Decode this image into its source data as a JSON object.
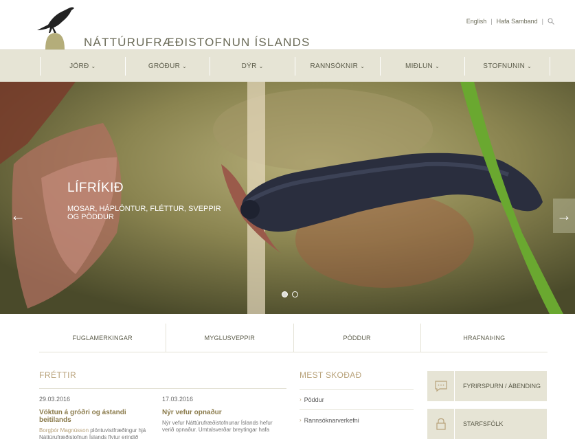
{
  "header": {
    "site_title": "NÁTTÚRUFRÆÐISTOFNUN ÍSLANDS",
    "util_links": [
      "English",
      "Hafa Samband"
    ]
  },
  "nav": {
    "items": [
      "JÖRÐ",
      "GRÓÐUR",
      "DÝR",
      "RANNSÓKNIR",
      "MIÐLUN",
      "STOFNUNIN"
    ]
  },
  "hero": {
    "title": "LÍFRÍKIÐ",
    "subtitle": "MOSAR, HÁPLÖNTUR, FLÉTTUR, SVEPPIR OG PÖDDUR",
    "arrow_left": "←",
    "arrow_right": "→"
  },
  "quicklinks": [
    "FUGLAMERKINGAR",
    "MYGLUSVEPPIR",
    "PÖDDUR",
    "HRAFNAÞING"
  ],
  "news": {
    "heading": "FRÉTTIR",
    "items": [
      {
        "date": "29.03.2016",
        "title": "Vöktun á gróðri og ástandi beitilands",
        "author": "Borgþór Magnússon",
        "text": "plöntuvistfræðingur hjá Náttúrufræðistofnun Íslands flytur erindið"
      },
      {
        "date": "17.03.2016",
        "title": "Nýr vefur opnaður",
        "author": "",
        "text": "Nýr vefur Náttúrufræðistofnunar Íslands hefur verið opnaður. Umtalsverðar breytingar hafa"
      }
    ]
  },
  "most_viewed": {
    "heading": "MEST SKOÐAÐ",
    "items": [
      "Pöddur",
      "Rannsóknarverkefni"
    ]
  },
  "sideboxes": [
    {
      "label": "FYRIRSPURN / ÁBENDING",
      "icon": "chat-icon"
    },
    {
      "label": "STARFSFÓLK",
      "icon": "lock-icon"
    }
  ],
  "colors": {
    "nav_bg": "#e6e4d5",
    "accent": "#b8a27a"
  }
}
